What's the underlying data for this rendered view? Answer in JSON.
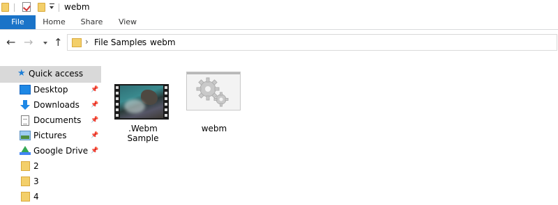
{
  "window": {
    "title": "webm"
  },
  "ribbon": {
    "tabs": [
      "File",
      "Home",
      "Share",
      "View"
    ]
  },
  "address": {
    "segments": [
      "File Samples",
      "webm"
    ]
  },
  "navpane": {
    "quick_access": "Quick access",
    "items": [
      {
        "label": "Desktop",
        "pinned": true,
        "icon": "desktop-icon"
      },
      {
        "label": "Downloads",
        "pinned": true,
        "icon": "downloads-icon"
      },
      {
        "label": "Documents",
        "pinned": true,
        "icon": "documents-icon"
      },
      {
        "label": "Pictures",
        "pinned": true,
        "icon": "pictures-icon"
      },
      {
        "label": "Google Drive",
        "pinned": true,
        "icon": "google-drive-icon"
      },
      {
        "label": "2",
        "pinned": false,
        "icon": "folder-icon"
      },
      {
        "label": "3",
        "pinned": false,
        "icon": "folder-icon"
      },
      {
        "label": "4",
        "pinned": false,
        "icon": "folder-icon"
      }
    ]
  },
  "files": [
    {
      "name": ".Webm Sample",
      "icon": "video-thumbnail"
    },
    {
      "name": "webm",
      "icon": "settings-file-icon"
    }
  ],
  "colors": {
    "file_tab": "#1a73c8",
    "selected_nav": "#d9d9d9",
    "folder": "#f3cf6a"
  }
}
